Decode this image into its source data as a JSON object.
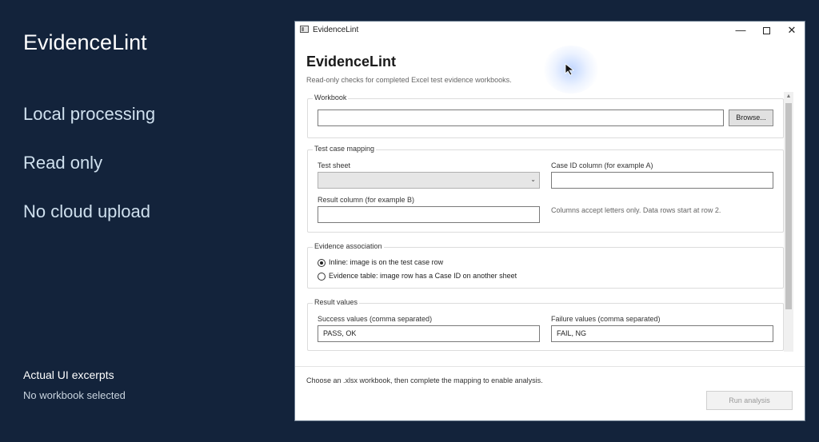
{
  "left": {
    "title": "EvidenceLint",
    "features": [
      "Local processing",
      "Read only",
      "No cloud upload"
    ],
    "excerpt_title": "Actual UI excerpts",
    "excerpt_status": "No workbook selected"
  },
  "window": {
    "title": "EvidenceLint",
    "controls": {
      "minimize": "—",
      "close": "✕"
    }
  },
  "app": {
    "title": "EvidenceLint",
    "subtitle": "Read-only checks for completed Excel test evidence workbooks."
  },
  "workbook": {
    "label": "Workbook",
    "path_value": "",
    "browse_label": "Browse..."
  },
  "mapping": {
    "label": "Test case mapping",
    "sheet_label": "Test sheet",
    "sheet_value": "",
    "case_id_label": "Case ID column (for example A)",
    "case_id_value": "",
    "result_label": "Result column (for example B)",
    "result_value": "",
    "hint": "Columns accept letters only. Data rows start at row 2."
  },
  "evidence": {
    "label": "Evidence association",
    "option_inline": "Inline: image is on the test case row",
    "option_table": "Evidence table: image row has a Case ID on another sheet",
    "selected": "inline"
  },
  "results": {
    "label": "Result values",
    "success_label": "Success values (comma separated)",
    "success_value": "PASS, OK",
    "failure_label": "Failure values (comma separated)",
    "failure_value": "FAIL, NG"
  },
  "footer": {
    "status": "Choose an .xlsx workbook, then complete the mapping to enable analysis.",
    "run_label": "Run analysis"
  },
  "colors": {
    "background": "#13233b",
    "feature_text": "#cfe0ee",
    "window_bg": "#ffffff",
    "disabled_text": "#999999"
  }
}
